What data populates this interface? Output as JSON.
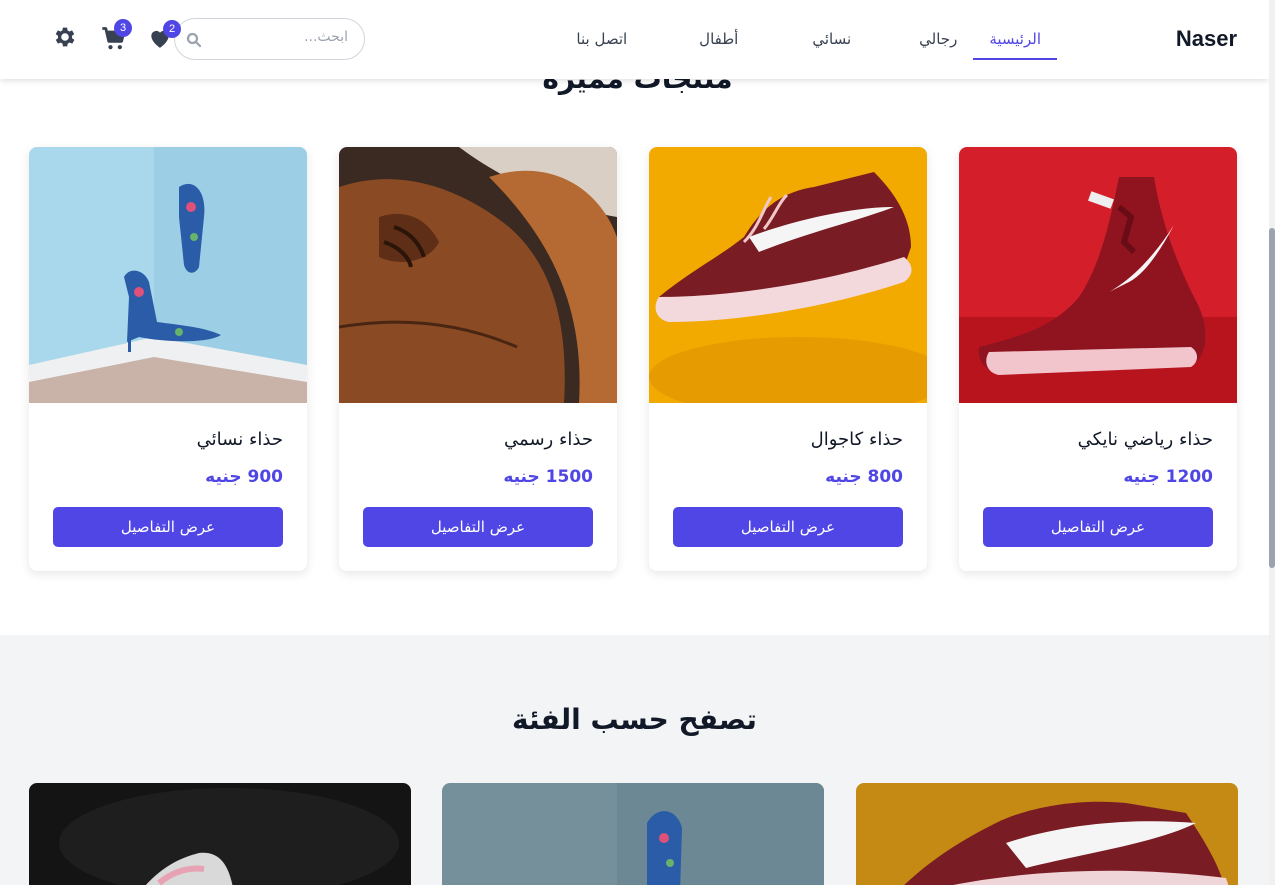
{
  "header": {
    "logo": "Naser",
    "nav": [
      {
        "label": "الرئيسية",
        "active": true
      },
      {
        "label": "رجالي",
        "active": false
      },
      {
        "label": "نسائي",
        "active": false
      },
      {
        "label": "أطفال",
        "active": false
      },
      {
        "label": "اتصل بنا",
        "active": false
      }
    ],
    "search": {
      "placeholder": "ابحث..."
    },
    "wishlist_count": "2",
    "cart_count": "3",
    "accent": "#4f46e5"
  },
  "featured": {
    "title": "منتجات مميزة",
    "products": [
      {
        "name": "حذاء رياضي نايكي",
        "price": "1200 جنيه",
        "button": "عرض التفاصيل",
        "image": "red-nike-sneaker"
      },
      {
        "name": "حذاء كاجوال",
        "price": "800 جنيه",
        "button": "عرض التفاصيل",
        "image": "maroon-casual-sneaker"
      },
      {
        "name": "حذاء رسمي",
        "price": "1500 جنيه",
        "button": "عرض التفاصيل",
        "image": "brown-leather-shoe"
      },
      {
        "name": "حذاء نسائي",
        "price": "900 جنيه",
        "button": "عرض التفاصيل",
        "image": "floral-high-heels"
      }
    ]
  },
  "categories": {
    "title": "تصفح حسب الفئة",
    "items": [
      {
        "image": "maroon-sneaker"
      },
      {
        "image": "floral-heel"
      },
      {
        "image": "dark-sneaker"
      }
    ]
  }
}
